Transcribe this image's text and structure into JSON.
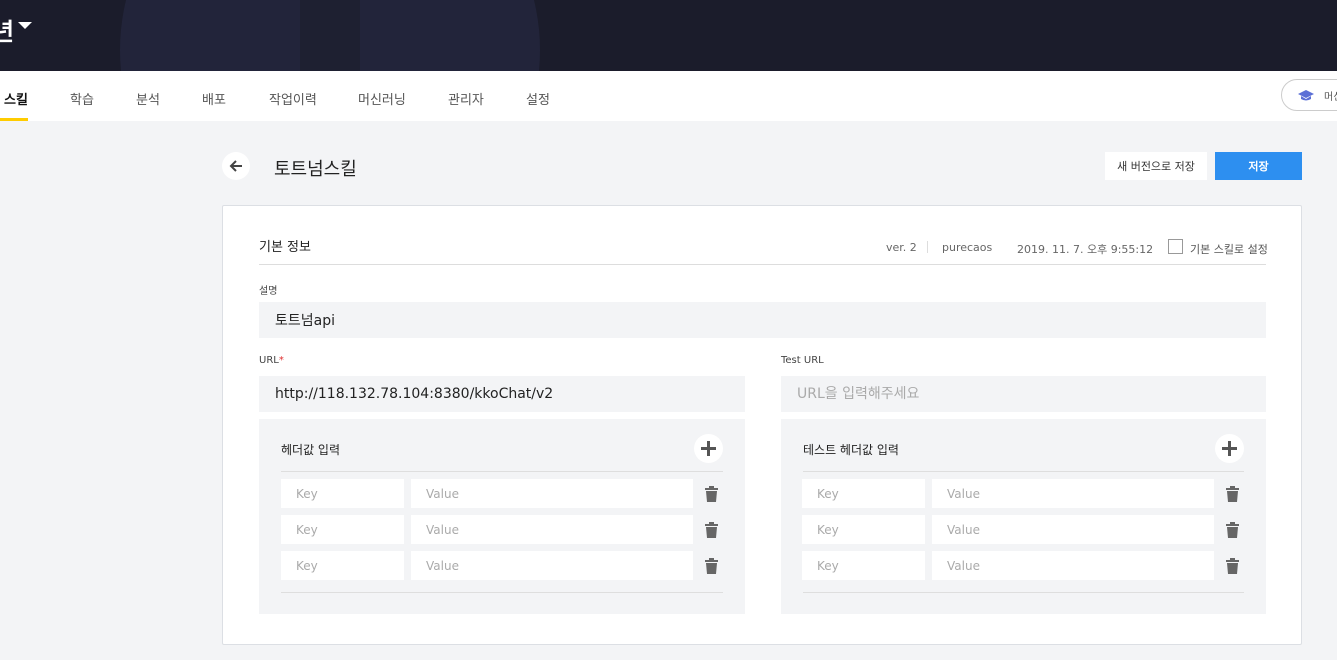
{
  "app": {
    "title_fragment": "년"
  },
  "nav": {
    "items": [
      {
        "label": "스킬",
        "active": true
      },
      {
        "label": "학습"
      },
      {
        "label": "분석"
      },
      {
        "label": "배포"
      },
      {
        "label": "작업이력"
      },
      {
        "label": "머신러닝"
      },
      {
        "label": "관리자"
      },
      {
        "label": "설정"
      }
    ],
    "pill_label": "머신",
    "accent": "#ffcc00"
  },
  "page": {
    "title": "토트넘스킬"
  },
  "actions": {
    "new_version_label": "새 버전으로 저장",
    "save_label": "저장",
    "save_color": "#2d8ff0"
  },
  "basic_info": {
    "title": "기본 정보",
    "version": "ver. 2",
    "author": "purecaos",
    "timestamp": "2019. 11. 7. 오후 9:55:12",
    "default_checkbox_label": "기본 스킬로 설정",
    "default_checked": false
  },
  "description": {
    "label": "설명",
    "value": "토트넘api"
  },
  "url": {
    "label": "URL",
    "required_mark": "*",
    "value": "http://118.132.78.104:8380/kkoChat/v2"
  },
  "test_url": {
    "label": "Test URL",
    "value": "",
    "placeholder": "URL을 입력해주세요"
  },
  "headers": {
    "title": "헤더값 입력",
    "key_placeholder": "Key",
    "value_placeholder": "Value",
    "rows": [
      {
        "key": "",
        "value": ""
      },
      {
        "key": "",
        "value": ""
      },
      {
        "key": "",
        "value": ""
      }
    ]
  },
  "test_headers": {
    "title": "테스트 헤더값 입력",
    "key_placeholder": "Key",
    "value_placeholder": "Value",
    "rows": [
      {
        "key": "",
        "value": ""
      },
      {
        "key": "",
        "value": ""
      },
      {
        "key": "",
        "value": ""
      }
    ]
  },
  "icons": [
    "caret-down-icon",
    "graduation-cap-icon",
    "arrow-left-icon",
    "plus-icon",
    "trash-icon",
    "checkbox-icon"
  ]
}
